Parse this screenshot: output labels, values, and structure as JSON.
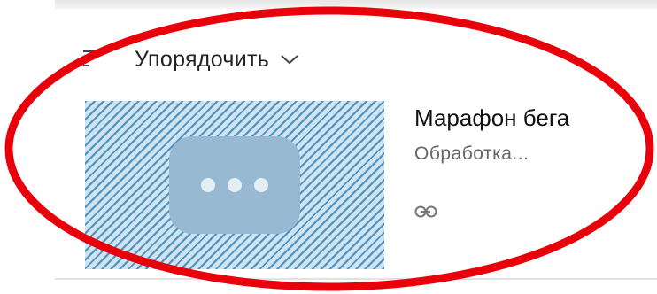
{
  "sort_bar": {
    "icon": "sort-lines-icon",
    "label": "Упорядочить",
    "chevron": "chevron-down-icon"
  },
  "video": {
    "title": "Марафон бега",
    "status": "Обработка...",
    "thumbnail_icon": "more-dots-icon",
    "link_icon": "link-icon"
  },
  "annotation": {
    "shape": "ellipse",
    "color": "#e8000a"
  },
  "colors": {
    "thumbnail_stripe": "#4f91bd",
    "thumbnail_placeholder": "#97b9d1",
    "title_text": "#111111",
    "status_text": "#666666"
  }
}
